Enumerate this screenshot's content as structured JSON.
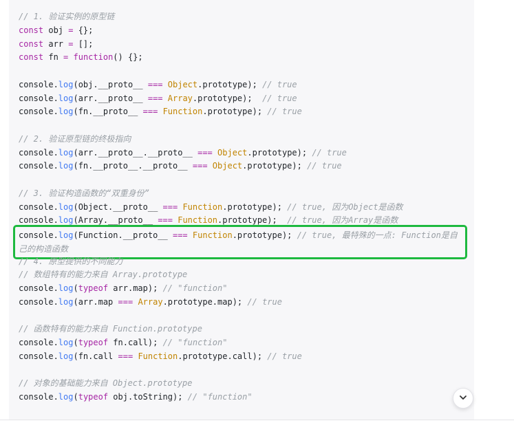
{
  "code_block": {
    "lines": [
      [
        {
          "t": "// 1. 验证实例的原型链",
          "c": "comment"
        }
      ],
      [
        {
          "t": "const",
          "c": "keyword"
        },
        {
          "t": " obj ",
          "c": "plain"
        },
        {
          "t": "=",
          "c": "op"
        },
        {
          "t": " {};",
          "c": "plain"
        }
      ],
      [
        {
          "t": "const",
          "c": "keyword"
        },
        {
          "t": " arr ",
          "c": "plain"
        },
        {
          "t": "=",
          "c": "op"
        },
        {
          "t": " [];",
          "c": "plain"
        }
      ],
      [
        {
          "t": "const",
          "c": "keyword"
        },
        {
          "t": " fn ",
          "c": "plain"
        },
        {
          "t": "=",
          "c": "op"
        },
        {
          "t": " ",
          "c": "plain"
        },
        {
          "t": "function",
          "c": "keyword"
        },
        {
          "t": "() {};",
          "c": "plain"
        }
      ],
      [],
      [
        {
          "t": "console.",
          "c": "plain"
        },
        {
          "t": "log",
          "c": "method"
        },
        {
          "t": "(obj.__proto__ ",
          "c": "plain"
        },
        {
          "t": "===",
          "c": "op"
        },
        {
          "t": " ",
          "c": "plain"
        },
        {
          "t": "Object",
          "c": "builtin"
        },
        {
          "t": ".prototype); ",
          "c": "plain"
        },
        {
          "t": "// true",
          "c": "comment"
        }
      ],
      [
        {
          "t": "console.",
          "c": "plain"
        },
        {
          "t": "log",
          "c": "method"
        },
        {
          "t": "(arr.__proto__ ",
          "c": "plain"
        },
        {
          "t": "===",
          "c": "op"
        },
        {
          "t": " ",
          "c": "plain"
        },
        {
          "t": "Array",
          "c": "builtin"
        },
        {
          "t": ".prototype);  ",
          "c": "plain"
        },
        {
          "t": "// true",
          "c": "comment"
        }
      ],
      [
        {
          "t": "console.",
          "c": "plain"
        },
        {
          "t": "log",
          "c": "method"
        },
        {
          "t": "(fn.__proto__ ",
          "c": "plain"
        },
        {
          "t": "===",
          "c": "op"
        },
        {
          "t": " ",
          "c": "plain"
        },
        {
          "t": "Function",
          "c": "builtin"
        },
        {
          "t": ".prototype); ",
          "c": "plain"
        },
        {
          "t": "// true",
          "c": "comment"
        }
      ],
      [],
      [
        {
          "t": "// 2. 验证原型链的终极指向",
          "c": "comment"
        }
      ],
      [
        {
          "t": "console.",
          "c": "plain"
        },
        {
          "t": "log",
          "c": "method"
        },
        {
          "t": "(arr.__proto__.__proto__ ",
          "c": "plain"
        },
        {
          "t": "===",
          "c": "op"
        },
        {
          "t": " ",
          "c": "plain"
        },
        {
          "t": "Object",
          "c": "builtin"
        },
        {
          "t": ".prototype); ",
          "c": "plain"
        },
        {
          "t": "// true",
          "c": "comment"
        }
      ],
      [
        {
          "t": "console.",
          "c": "plain"
        },
        {
          "t": "log",
          "c": "method"
        },
        {
          "t": "(fn.__proto__.__proto__ ",
          "c": "plain"
        },
        {
          "t": "===",
          "c": "op"
        },
        {
          "t": " ",
          "c": "plain"
        },
        {
          "t": "Object",
          "c": "builtin"
        },
        {
          "t": ".prototype); ",
          "c": "plain"
        },
        {
          "t": "// true",
          "c": "comment"
        }
      ],
      [],
      [
        {
          "t": "// 3. 验证构造函数的“双重身份”",
          "c": "comment"
        }
      ],
      [
        {
          "t": "console.",
          "c": "plain"
        },
        {
          "t": "log",
          "c": "method"
        },
        {
          "t": "(Object.__proto__ ",
          "c": "plain"
        },
        {
          "t": "===",
          "c": "op"
        },
        {
          "t": " ",
          "c": "plain"
        },
        {
          "t": "Function",
          "c": "builtin"
        },
        {
          "t": ".prototype); ",
          "c": "plain"
        },
        {
          "t": "// true, 因为Object是函数",
          "c": "comment"
        }
      ],
      [
        {
          "t": "console.",
          "c": "plain"
        },
        {
          "t": "log",
          "c": "method"
        },
        {
          "t": "(Array.__proto__ ",
          "c": "plain"
        },
        {
          "t": "===",
          "c": "op"
        },
        {
          "t": " ",
          "c": "plain"
        },
        {
          "t": "Function",
          "c": "builtin"
        },
        {
          "t": ".prototype);  ",
          "c": "plain"
        },
        {
          "t": "// true, 因为Array是函数",
          "c": "comment"
        }
      ],
      [
        {
          "t": "console.",
          "c": "plain"
        },
        {
          "t": "log",
          "c": "method"
        },
        {
          "t": "(Function.__proto__ ",
          "c": "plain"
        },
        {
          "t": "===",
          "c": "op"
        },
        {
          "t": " ",
          "c": "plain"
        },
        {
          "t": "Function",
          "c": "builtin"
        },
        {
          "t": ".prototype); ",
          "c": "plain"
        },
        {
          "t": "// true, 最特殊的一点: Function是自己的构造函数",
          "c": "comment"
        }
      ],
      [],
      [
        {
          "t": "// 4. 原型提供的不同能力",
          "c": "comment"
        }
      ],
      [
        {
          "t": "// 数组特有的能力来自 Array.prototype",
          "c": "comment"
        }
      ],
      [
        {
          "t": "console.",
          "c": "plain"
        },
        {
          "t": "log",
          "c": "method"
        },
        {
          "t": "(",
          "c": "plain"
        },
        {
          "t": "typeof",
          "c": "keyword"
        },
        {
          "t": " arr.map); ",
          "c": "plain"
        },
        {
          "t": "// \"function\"",
          "c": "comment"
        }
      ],
      [
        {
          "t": "console.",
          "c": "plain"
        },
        {
          "t": "log",
          "c": "method"
        },
        {
          "t": "(arr.map ",
          "c": "plain"
        },
        {
          "t": "===",
          "c": "op"
        },
        {
          "t": " ",
          "c": "plain"
        },
        {
          "t": "Array",
          "c": "builtin"
        },
        {
          "t": ".prototype.map); ",
          "c": "plain"
        },
        {
          "t": "// true",
          "c": "comment"
        }
      ],
      [],
      [
        {
          "t": "// 函数特有的能力来自 Function.prototype",
          "c": "comment"
        }
      ],
      [
        {
          "t": "console.",
          "c": "plain"
        },
        {
          "t": "log",
          "c": "method"
        },
        {
          "t": "(",
          "c": "plain"
        },
        {
          "t": "typeof",
          "c": "keyword"
        },
        {
          "t": " fn.call); ",
          "c": "plain"
        },
        {
          "t": "// \"function\"",
          "c": "comment"
        }
      ],
      [
        {
          "t": "console.",
          "c": "plain"
        },
        {
          "t": "log",
          "c": "method"
        },
        {
          "t": "(fn.call ",
          "c": "plain"
        },
        {
          "t": "===",
          "c": "op"
        },
        {
          "t": " ",
          "c": "plain"
        },
        {
          "t": "Function",
          "c": "builtin"
        },
        {
          "t": ".prototype.call); ",
          "c": "plain"
        },
        {
          "t": "// true",
          "c": "comment"
        }
      ],
      [],
      [
        {
          "t": "// 对象的基础能力来自 Object.prototype",
          "c": "comment"
        }
      ],
      [
        {
          "t": "console.",
          "c": "plain"
        },
        {
          "t": "log",
          "c": "method"
        },
        {
          "t": "(",
          "c": "plain"
        },
        {
          "t": "typeof",
          "c": "keyword"
        },
        {
          "t": " obj.toString); ",
          "c": "plain"
        },
        {
          "t": "// \"function\"",
          "c": "comment"
        }
      ]
    ],
    "highlighted_line": 16
  },
  "scroll_button": {
    "icon": "chevron-down-icon"
  },
  "colors": {
    "highlight_border": "#1db93f",
    "panel_background": "#f7f7f9",
    "comment": "#9aa0a6",
    "keyword": "#a626a4",
    "builtin": "#c18401",
    "method": "#4078f2"
  }
}
